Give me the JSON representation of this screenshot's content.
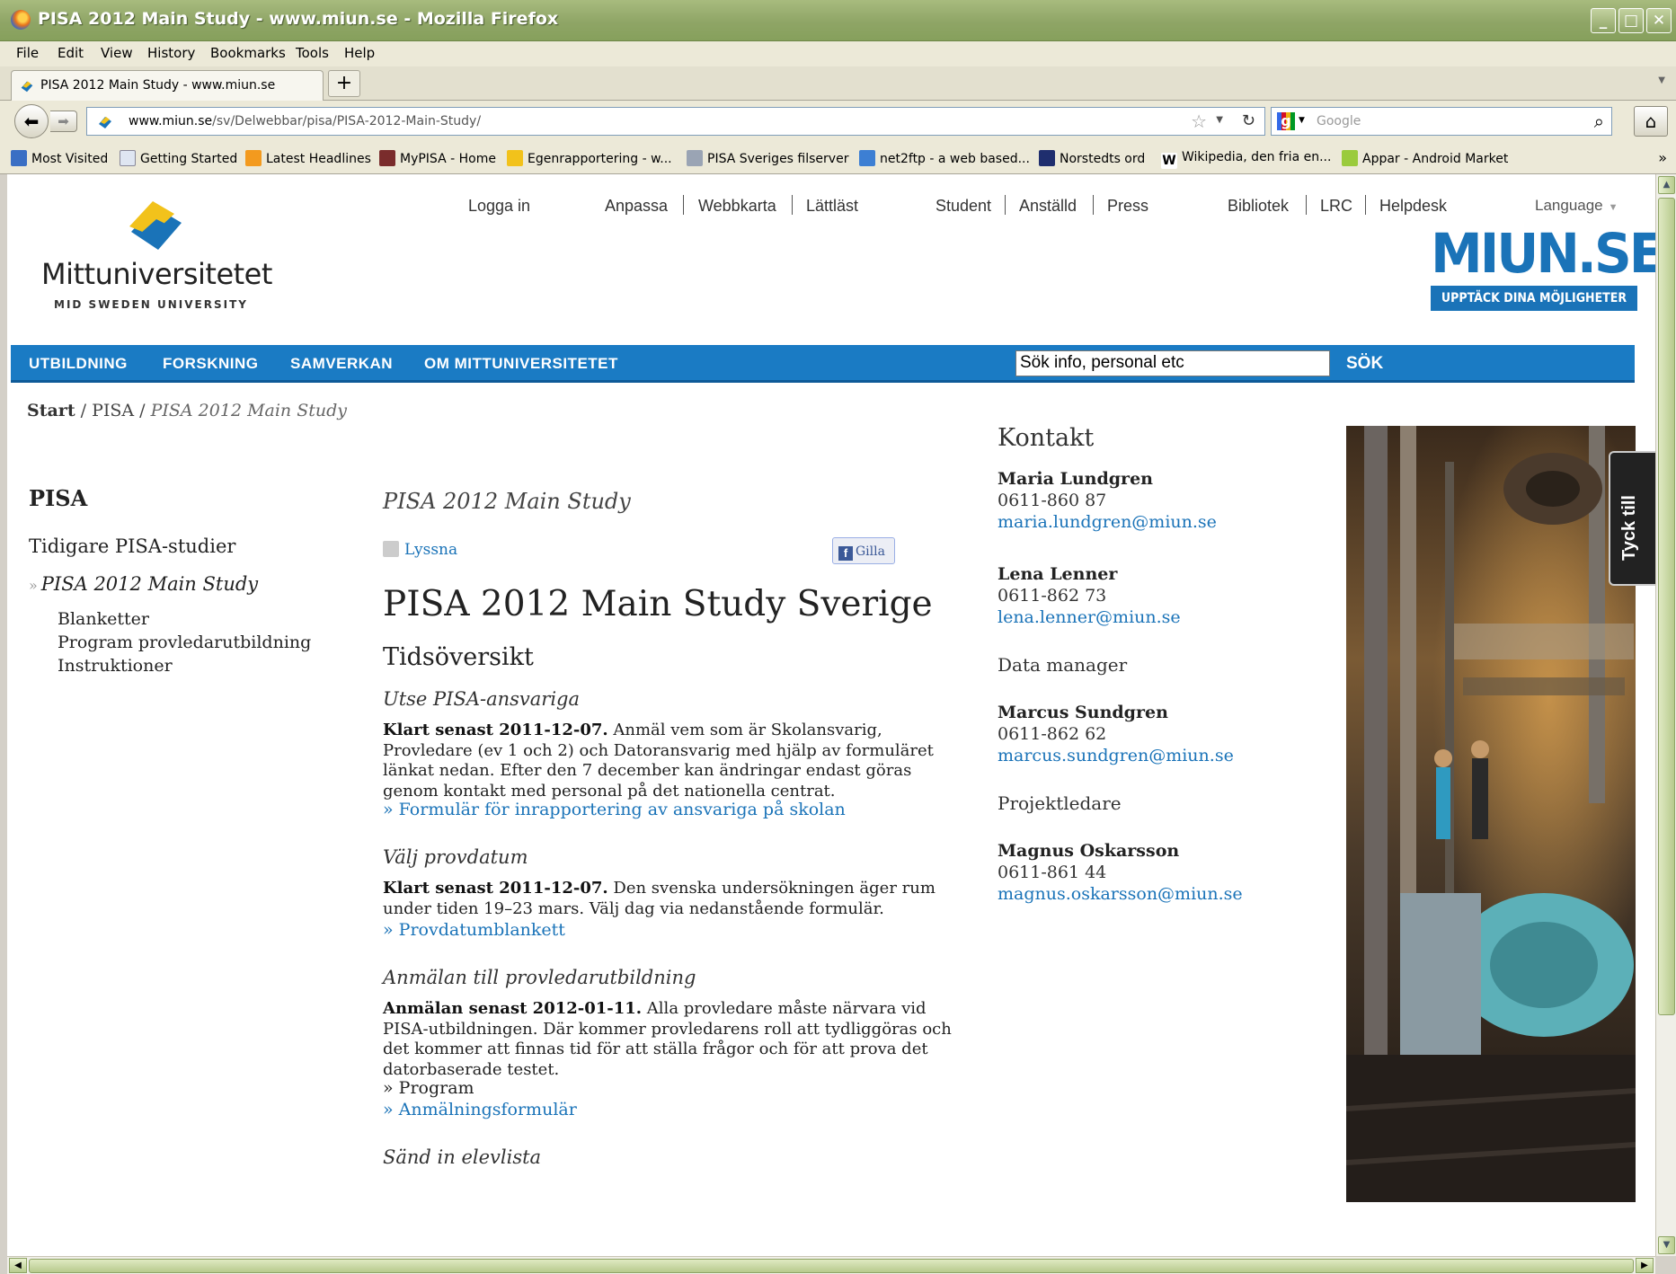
{
  "window": {
    "title": "PISA 2012 Main Study - www.miun.se - Mozilla Firefox"
  },
  "menu": [
    "File",
    "Edit",
    "View",
    "History",
    "Bookmarks",
    "Tools",
    "Help"
  ],
  "tab": {
    "label": "PISA 2012 Main Study - www.miun.se",
    "new_tab": "+"
  },
  "nav": {
    "url_host": "www.miun.se",
    "url_path": "/sv/Delwebbar/pisa/PISA-2012-Main-Study/",
    "search_placeholder": "Google"
  },
  "bookmarks": [
    {
      "label": "Most Visited",
      "color": "#3a6fc4"
    },
    {
      "label": "Getting Started",
      "color": "#dfe6f2"
    },
    {
      "label": "Latest Headlines",
      "color": "#f39a1e"
    },
    {
      "label": "MyPISA - Home",
      "color": "#7a2c2c"
    },
    {
      "label": "Egenrapportering - w...",
      "color": "#f2c21b"
    },
    {
      "label": "PISA Sveriges filserver",
      "color": "#9aa4b4"
    },
    {
      "label": "net2ftp - a web based...",
      "color": "#3d7fd3"
    },
    {
      "label": "Norstedts ord",
      "color": "#1f2e6e"
    },
    {
      "label": "Wikipedia, den fria en...",
      "color": "#ffffff"
    },
    {
      "label": "Appar - Android Market",
      "color": "#9acb3c"
    }
  ],
  "site": {
    "logo_name": "Mittuniversitetet",
    "logo_sub": "MID SWEDEN UNIVERSITY",
    "top_links": [
      "Logga in",
      "Anpassa",
      "Webbkarta",
      "Lättläst",
      "Student",
      "Anställd",
      "Press",
      "Bibliotek",
      "LRC",
      "Helpdesk"
    ],
    "language": "Language",
    "miun_logo": "MIUN.SE",
    "miun_tagline": "UPPTÄCK DINA MÖJLIGHETER",
    "main_nav": [
      "UTBILDNING",
      "FORSKNING",
      "SAMVERKAN",
      "OM MITTUNIVERSITETET"
    ],
    "search_value": "Sök info, personal etc",
    "search_button": "SÖK"
  },
  "breadcrumb": {
    "start": "Start",
    "sep1": " / ",
    "pisa": "PISA",
    "sep2": " / ",
    "current": "PISA 2012 Main Study"
  },
  "left_nav": {
    "heading": "PISA",
    "item1": "Tidigare PISA-studier",
    "active_arrow": "»",
    "active": "PISA 2012 Main Study",
    "sub": [
      "Blanketter",
      "Program provledarutbildning",
      "Instruktioner"
    ]
  },
  "content": {
    "kicker": "PISA 2012 Main Study",
    "lyssna": "Lyssna",
    "gilla": "Gilla",
    "h1": "PISA 2012 Main Study Sverige",
    "h2": "Tidsöversikt",
    "s1_title": "Utse PISA-ansvariga",
    "s1_bold": "Klart senast 2011-12-07.",
    "s1_text": " Anmäl vem som är Skolansvarig, Provledare (ev 1 och 2) och Datoransvarig med hjälp av formuläret länkat nedan. Efter den 7 december kan ändringar endast göras genom kontakt med personal på det nationella centrat.",
    "s1_link": "» Formulär för inrapportering av ansvariga på skolan",
    "s2_title": "Välj provdatum",
    "s2_bold": "Klart senast 2011-12-07.",
    "s2_text": " Den svenska undersökningen äger rum under tiden 19–23 mars. Välj dag via nedanstående formulär.",
    "s2_link": "» Provdatumblankett",
    "s3_title": "Anmälan till provledarutbildning",
    "s3_bold": "Anmälan senast 2012-01-11.",
    "s3_text": " Alla provledare måste närvara vid PISA-utbildningen. Där kommer provledarens roll att tydliggöras och det kommer att finnas tid för att ställa frågor och för att prova det datorbaserade testet.",
    "s3_plain": "» Program",
    "s3_link": "» Anmälningsformulär",
    "s4_title": "Sänd in elevlista"
  },
  "contact": {
    "heading": "Kontakt",
    "p1_name": "Maria Lundgren",
    "p1_phone": "0611-860 87",
    "p1_email": "maria.lundgren@miun.se",
    "p2_name": "Lena Lenner",
    "p2_phone": "0611-862 73",
    "p2_email": "lena.lenner@miun.se",
    "role1": "Data manager",
    "p3_name": "Marcus Sundgren",
    "p3_phone": "0611-862 62",
    "p3_email": "marcus.sundgren@miun.se",
    "role2": "Projektledare",
    "p4_name": "Magnus Oskarsson",
    "p4_phone": "0611-861 44",
    "p4_email": "magnus.oskarsson@miun.se"
  },
  "feedback_tab": "Tyck till",
  "colors": {
    "brand_blue": "#1a7bc4",
    "link_blue": "#1a73b8",
    "title_green": "#8fa566"
  }
}
